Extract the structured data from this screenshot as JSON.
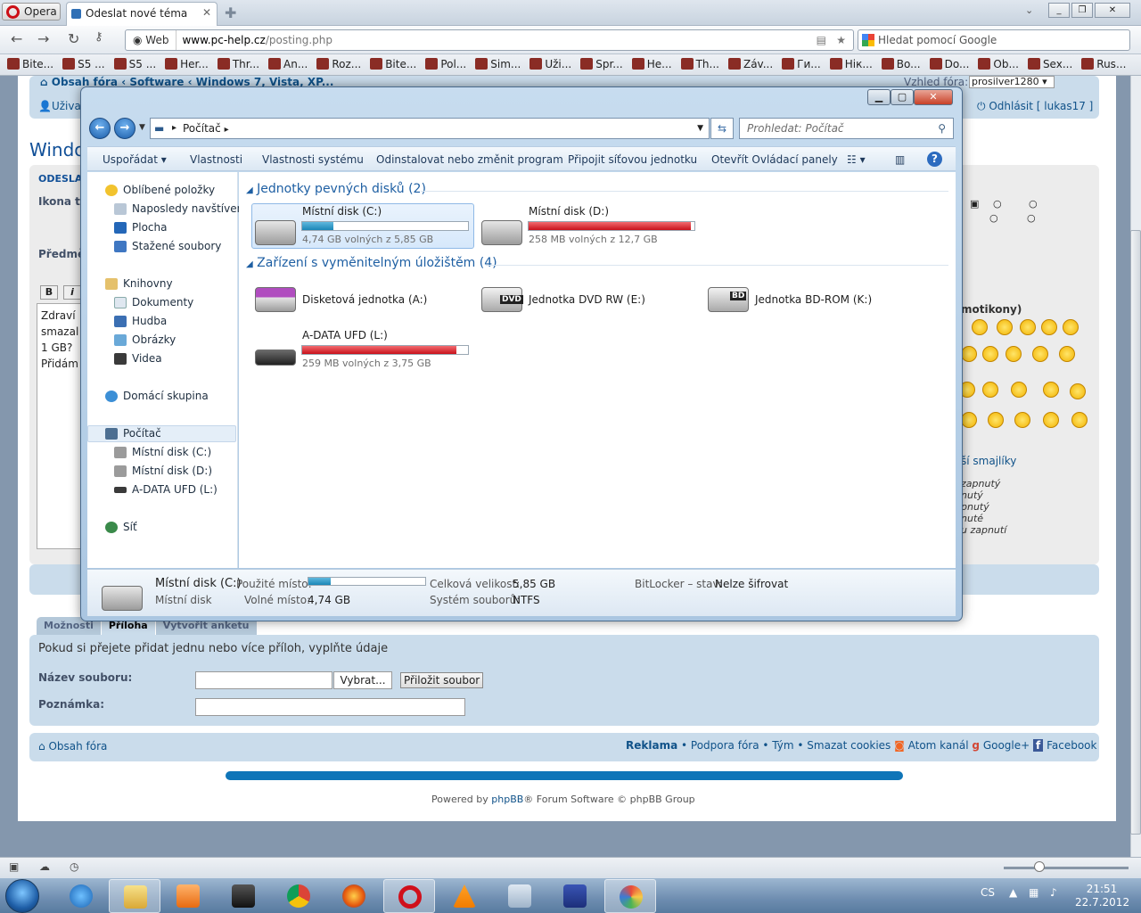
{
  "browser": {
    "menu_label": "Opera",
    "tab_title": "Odeslat nové téma",
    "address_web": "Web",
    "address_domain": "www.pc-help.cz",
    "address_path": "/posting.php",
    "search_placeholder": "Hledat pomocí Google",
    "bookmarks": [
      "Bite...",
      "S5 ...",
      "S5 ...",
      "Her...",
      "Thr...",
      "An...",
      "Roz...",
      "Bite...",
      "Pol...",
      "Sim...",
      "Uži...",
      "Spr...",
      "He...",
      "Th...",
      "Záv...",
      "Ги...",
      "Hік...",
      "Bo...",
      "Do...",
      "Ob...",
      "Sex...",
      "Rus..."
    ]
  },
  "forum": {
    "breadcrumb_home": "Obsah fóra",
    "breadcrumb_software": "Software",
    "breadcrumb_windows": "Windows 7, Vista, XP...",
    "style_label": "Vzhled fóra:",
    "style_value": "prosilver1280",
    "user_left": "Uživa",
    "logout": "Odhlásit",
    "username": "lukas17",
    "title_fragment": "Windo",
    "post_heading": "ODESLAT",
    "icon_label": "Ikona t",
    "subject_label": "Předmě",
    "bold_btn": "B",
    "italic_btn": "i",
    "text_lines": [
      "Zdraví",
      "smazal",
      "1 GB?",
      "Přidám"
    ],
    "smilies_title": "motikony)",
    "more_smilies": "ší smajlíky",
    "options": [
      "zapnutý",
      "nutý",
      "pnutý",
      "nuté",
      "u zapnutí"
    ],
    "tab_options": "Možnosti",
    "tab_attach": "Příloha",
    "tab_poll": "Vytvořit anketu",
    "attach_info": "Pokud si přejete přidat jednu nebo více příloh, vyplňte údaje",
    "filename_label": "Název souboru:",
    "browse_btn": "Vybrat...",
    "attach_btn": "Přiložit soubor",
    "note_label": "Poznámka:",
    "footer_home": "Obsah fóra",
    "footer_reklama": "Reklama",
    "footer_podpora": "Podpora fóra",
    "footer_tym": "Tým",
    "footer_cookies": "Smazat cookies",
    "footer_atom": "Atom kanál",
    "footer_gplus": "Google+",
    "footer_fb": "Facebook",
    "powered_pre": "Powered by",
    "powered_link": "phpBB",
    "powered_post": "® Forum Software © phpBB Group"
  },
  "explorer": {
    "breadcrumb": "Počítač",
    "search_placeholder": "Prohledat: Počítač",
    "toolbar": [
      "Uspořádat",
      "Vlastnosti",
      "Vlastnosti systému",
      "Odinstalovat nebo změnit program",
      "Připojit síťovou jednotku",
      "Otevřít Ovládací panely"
    ],
    "nav": {
      "favorites": "Oblíbené položky",
      "recent": "Naposledy navštívené",
      "desktop": "Plocha",
      "downloads": "Stažené soubory",
      "libraries": "Knihovny",
      "documents": "Dokumenty",
      "music": "Hudba",
      "pictures": "Obrázky",
      "videos": "Videa",
      "homegroup": "Domácí skupina",
      "computer": "Počítač",
      "disk_c": "Místní disk (C:)",
      "disk_d": "Místní disk (D:)",
      "usb": "A-DATA UFD (L:)",
      "network": "Síť"
    },
    "group_hdd": "Jednotky pevných disků (2)",
    "group_removable": "Zařízení s vyměnitelným úložištěm (4)",
    "drives": [
      {
        "name": "Místní disk (C:)",
        "free": "4,74 GB volných z 5,85 GB",
        "used_fraction": 0.19
      },
      {
        "name": "Místní disk (D:)",
        "free": "258 MB volných z 12,7 GB",
        "used_fraction": 0.98
      },
      {
        "name": "A-DATA UFD (L:)",
        "free": "259 MB volných z 3,75 GB",
        "used_fraction": 0.93
      }
    ],
    "removable": [
      "Disketová jednotka (A:)",
      "Jednotka DVD RW (E:)",
      "Jednotka BD-ROM (K:)"
    ],
    "dvd_badge": "DVD",
    "bd_badge": "BD",
    "details": {
      "name": "Místní disk (C:)",
      "type": "Místní disk",
      "used_label": "Použité místo:",
      "used_fraction": 0.19,
      "free_label": "Volné místo:",
      "free_value": "4,74 GB",
      "total_label": "Celková velikost:",
      "total_value": "5,85 GB",
      "fs_label": "Systém souborů:",
      "fs_value": "NTFS",
      "bitlocker_label": "BitLocker – stav:",
      "bitlocker_value": "Nelze šifrovat"
    }
  },
  "taskbar": {
    "lang": "CS",
    "time": "21:51",
    "date": "22.7.2012"
  }
}
